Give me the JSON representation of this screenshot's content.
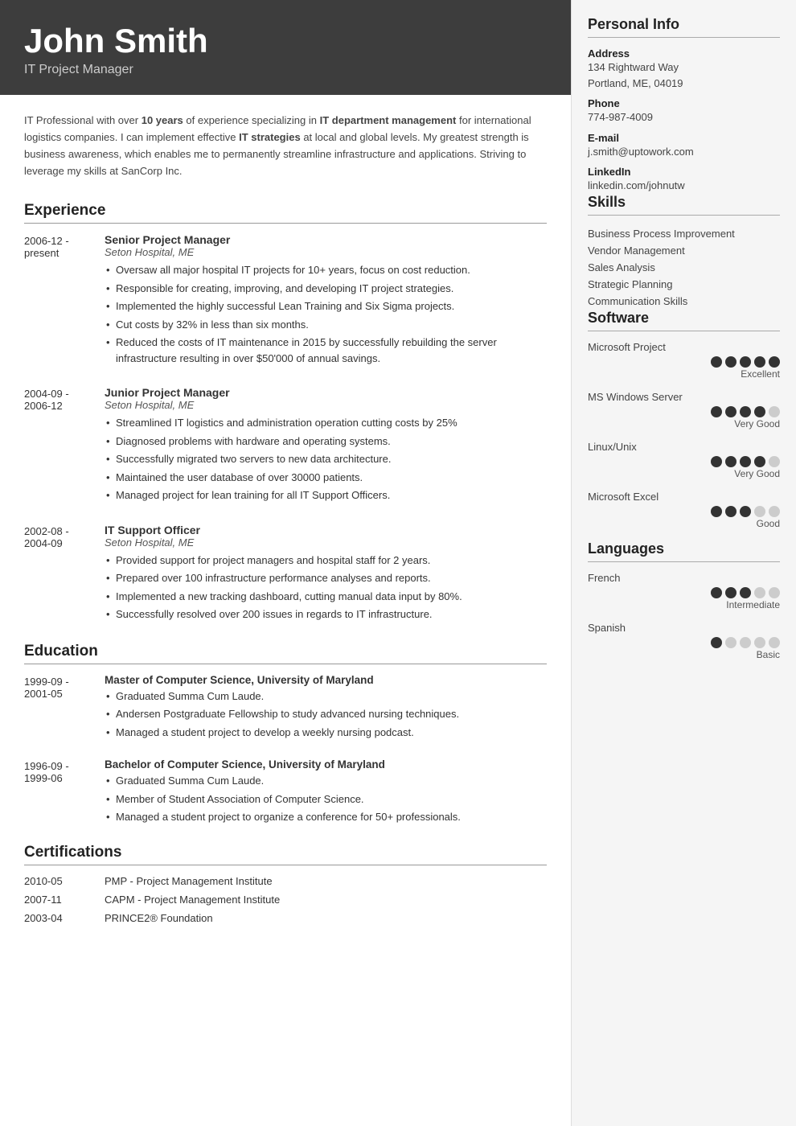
{
  "header": {
    "name": "John Smith",
    "title": "IT Project Manager"
  },
  "summary": {
    "text_parts": [
      "IT Professional with over ",
      "10 years",
      " of experience specializing in ",
      "IT department management",
      " for international logistics companies. I can implement effective ",
      "IT strategies",
      " at local and global levels. My greatest strength is business awareness, which enables me to permanently streamline infrastructure and applications. Striving to leverage my skills at SanCorp Inc."
    ]
  },
  "experience": {
    "section_title": "Experience",
    "items": [
      {
        "date_start": "2006-12 -",
        "date_end": "present",
        "title": "Senior Project Manager",
        "company": "Seton Hospital, ME",
        "bullets": [
          "Oversaw all major hospital IT projects for 10+ years, focus on cost reduction.",
          "Responsible for creating, improving, and developing IT project strategies.",
          "Implemented the highly successful Lean Training and Six Sigma projects.",
          "Cut costs by 32% in less than six months.",
          "Reduced the costs of IT maintenance in 2015 by successfully rebuilding the server infrastructure resulting in over $50'000 of annual savings."
        ]
      },
      {
        "date_start": "2004-09 -",
        "date_end": "2006-12",
        "title": "Junior Project Manager",
        "company": "Seton Hospital, ME",
        "bullets": [
          "Streamlined IT logistics and administration operation cutting costs by 25%",
          "Diagnosed problems with hardware and operating systems.",
          "Successfully migrated two servers to new data architecture.",
          "Maintained the user database of over 30000 patients.",
          "Managed project for lean training for all IT Support Officers."
        ]
      },
      {
        "date_start": "2002-08 -",
        "date_end": "2004-09",
        "title": "IT Support Officer",
        "company": "Seton Hospital, ME",
        "bullets": [
          "Provided support for project managers and hospital staff for 2 years.",
          "Prepared over 100 infrastructure performance analyses and reports.",
          "Implemented a new tracking dashboard, cutting manual data input by 80%.",
          "Successfully resolved over 200 issues in regards to IT infrastructure."
        ]
      }
    ]
  },
  "education": {
    "section_title": "Education",
    "items": [
      {
        "date_start": "1999-09 -",
        "date_end": "2001-05",
        "degree": "Master of Computer Science, University of Maryland",
        "bullets": [
          "Graduated Summa Cum Laude.",
          "Andersen Postgraduate Fellowship to study advanced nursing techniques.",
          "Managed a student project to develop a weekly nursing podcast."
        ]
      },
      {
        "date_start": "1996-09 -",
        "date_end": "1999-06",
        "degree": "Bachelor of Computer Science, University of Maryland",
        "bullets": [
          "Graduated Summa Cum Laude.",
          "Member of Student Association of Computer Science.",
          "Managed a student project to organize a conference for 50+ professionals."
        ]
      }
    ]
  },
  "certifications": {
    "section_title": "Certifications",
    "items": [
      {
        "date": "2010-05",
        "name": "PMP - Project Management Institute"
      },
      {
        "date": "2007-11",
        "name": "CAPM - Project Management Institute"
      },
      {
        "date": "2003-04",
        "name": "PRINCE2® Foundation"
      }
    ]
  },
  "personal_info": {
    "section_title": "Personal Info",
    "address_label": "Address",
    "address": "134 Rightward Way\nPortland, ME, 04019",
    "phone_label": "Phone",
    "phone": "774-987-4009",
    "email_label": "E-mail",
    "email": "j.smith@uptowork.com",
    "linkedin_label": "LinkedIn",
    "linkedin": "linkedin.com/johnutw"
  },
  "skills": {
    "section_title": "Skills",
    "items": [
      "Business Process Improvement",
      "Vendor Management",
      "Sales Analysis",
      "Strategic Planning",
      "Communication Skills"
    ]
  },
  "software": {
    "section_title": "Software",
    "items": [
      {
        "name": "Microsoft Project",
        "filled": 5,
        "total": 5,
        "rating": "Excellent"
      },
      {
        "name": "MS Windows Server",
        "filled": 4,
        "total": 5,
        "rating": "Very Good"
      },
      {
        "name": "Linux/Unix",
        "filled": 4,
        "total": 5,
        "rating": "Very Good"
      },
      {
        "name": "Microsoft Excel",
        "filled": 3,
        "total": 5,
        "rating": "Good"
      }
    ]
  },
  "languages": {
    "section_title": "Languages",
    "items": [
      {
        "name": "French",
        "filled": 3,
        "total": 5,
        "rating": "Intermediate"
      },
      {
        "name": "Spanish",
        "filled": 1,
        "total": 5,
        "rating": "Basic"
      }
    ]
  }
}
